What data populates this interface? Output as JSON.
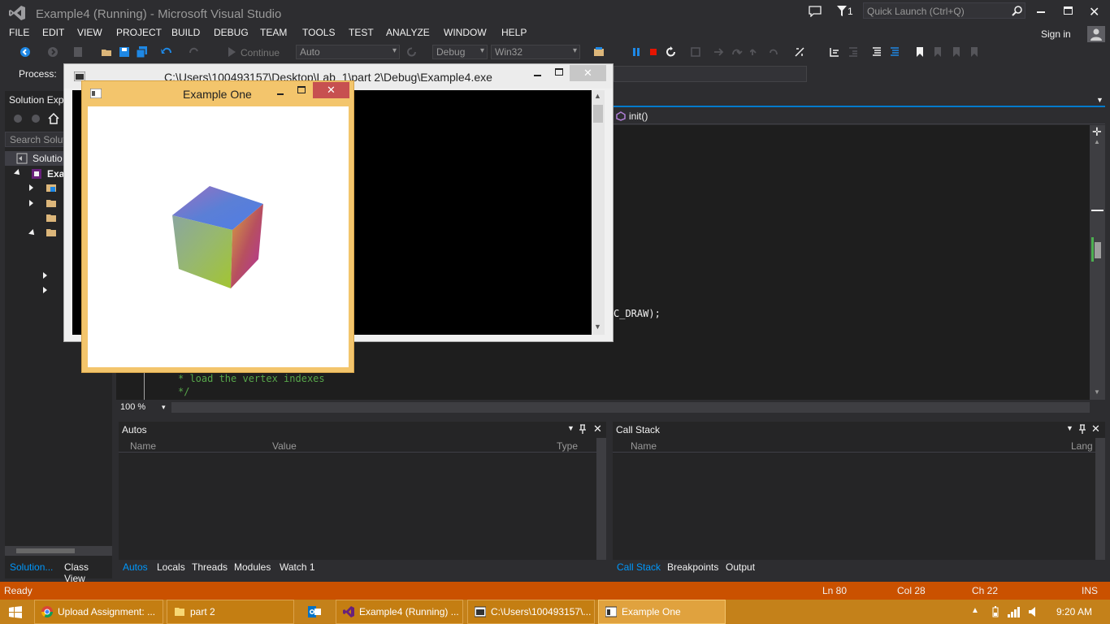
{
  "window": {
    "title": "Example4 (Running) - Microsoft Visual Studio"
  },
  "titlebar": {
    "notifications": "1",
    "quick_launch_placeholder": "Quick Launch (Ctrl+Q)",
    "sign_in": "Sign in"
  },
  "menu": [
    "FILE",
    "EDIT",
    "VIEW",
    "PROJECT",
    "BUILD",
    "DEBUG",
    "TEAM",
    "TOOLS",
    "TEST",
    "ANALYZE",
    "WINDOW",
    "HELP"
  ],
  "toolbar": {
    "continue_label": "Continue",
    "auto_value": "Auto",
    "config_value": "Debug",
    "platform_value": "Win32",
    "process_label": "Process:"
  },
  "solution_explorer": {
    "title": "Solution Exp...",
    "search_placeholder": "Search Soluti",
    "solution_item": "Solutio",
    "project_item": "Exa"
  },
  "editor": {
    "function_dropdown": "init()",
    "zoom": "100 %",
    "code_line_draw": "C_DRAW);",
    "code_comment_1": "*  load the vertex indexes",
    "code_comment_2": "*/"
  },
  "console": {
    "title": "C:\\Users\\100493157\\Desktop\\Lab_1\\part 2\\Debug\\Example4.exe"
  },
  "example_window": {
    "title": "Example One"
  },
  "autos": {
    "title": "Autos",
    "columns": [
      "Name",
      "Value",
      "Type"
    ]
  },
  "callstack": {
    "title": "Call Stack",
    "columns": [
      "Name",
      "Lang"
    ]
  },
  "bottom_tabs_left": [
    "Solution...",
    "Class View"
  ],
  "debug_tabs": [
    "Autos",
    "Locals",
    "Threads",
    "Modules",
    "Watch 1"
  ],
  "debug_tabs_right": [
    "Call Stack",
    "Breakpoints",
    "Output"
  ],
  "statusbar": {
    "status": "Ready",
    "ln": "Ln 80",
    "col": "Col 28",
    "ch": "Ch 22",
    "mode": "INS"
  },
  "taskbar": {
    "items": [
      "Upload Assignment: ...",
      "part 2",
      "",
      "Example4 (Running) ...",
      "C:\\Users\\100493157\\...",
      "Example One"
    ],
    "time": "9:20 AM"
  },
  "colors": {
    "status_bar": "#ca5100",
    "taskbar": "#c47e12",
    "accent": "#0097fb",
    "close_red": "#c75050"
  }
}
